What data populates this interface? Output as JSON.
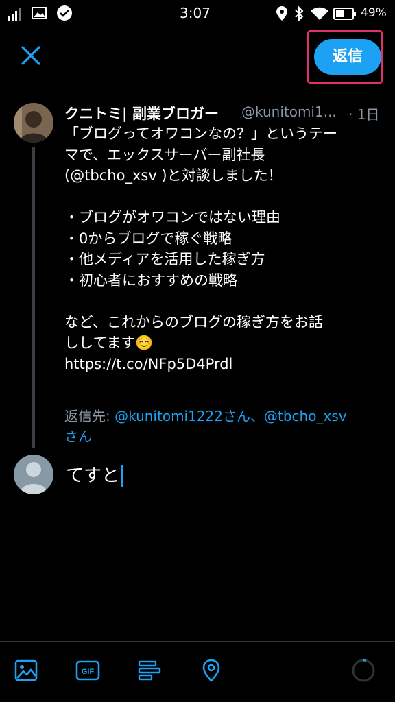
{
  "status_bar": {
    "time": "3:07",
    "battery_percent": "49%",
    "icons": [
      "signal-icon",
      "image-icon",
      "check-circle-icon",
      "location-icon",
      "bluetooth-icon",
      "wifi-icon",
      "battery-icon"
    ]
  },
  "header": {
    "close_icon": "close-icon",
    "reply_label": "返信"
  },
  "tweet": {
    "author_name": "クニトミ| 副業ブロガー",
    "handle": "@kunitomi1...",
    "time": "· 1日",
    "lines": [
      "「ブログってオワコンなの？」というテー",
      "マで、エックスサーバー副社長",
      "(@tbcho_xsv )と対談しました！",
      "",
      "・ブログがオワコンではない理由",
      "・0からブログで稼ぐ戦略",
      "・他メディアを活用した稼ぎ方",
      "・初心者におすすめの戦略",
      "",
      "など、これからのブログの稼ぎ方をお話",
      "ししてます☺️",
      "https://t.co/NFp5D4Prdl"
    ]
  },
  "reply_to": {
    "prefix": "返信先:",
    "mention1": "@kunitomi1222さん",
    "separator": "、",
    "mention2": "@tbcho_xsv",
    "line2": "さん"
  },
  "compose": {
    "text": "てすと"
  },
  "toolbar": {
    "icons": [
      "image-icon",
      "gif-icon",
      "poll-icon",
      "location-icon"
    ],
    "accent": "#1da1f2"
  },
  "colors": {
    "accent": "#1da1f2",
    "muted": "#8b98a5",
    "highlight_border": "#e0306a",
    "background": "#000000"
  }
}
